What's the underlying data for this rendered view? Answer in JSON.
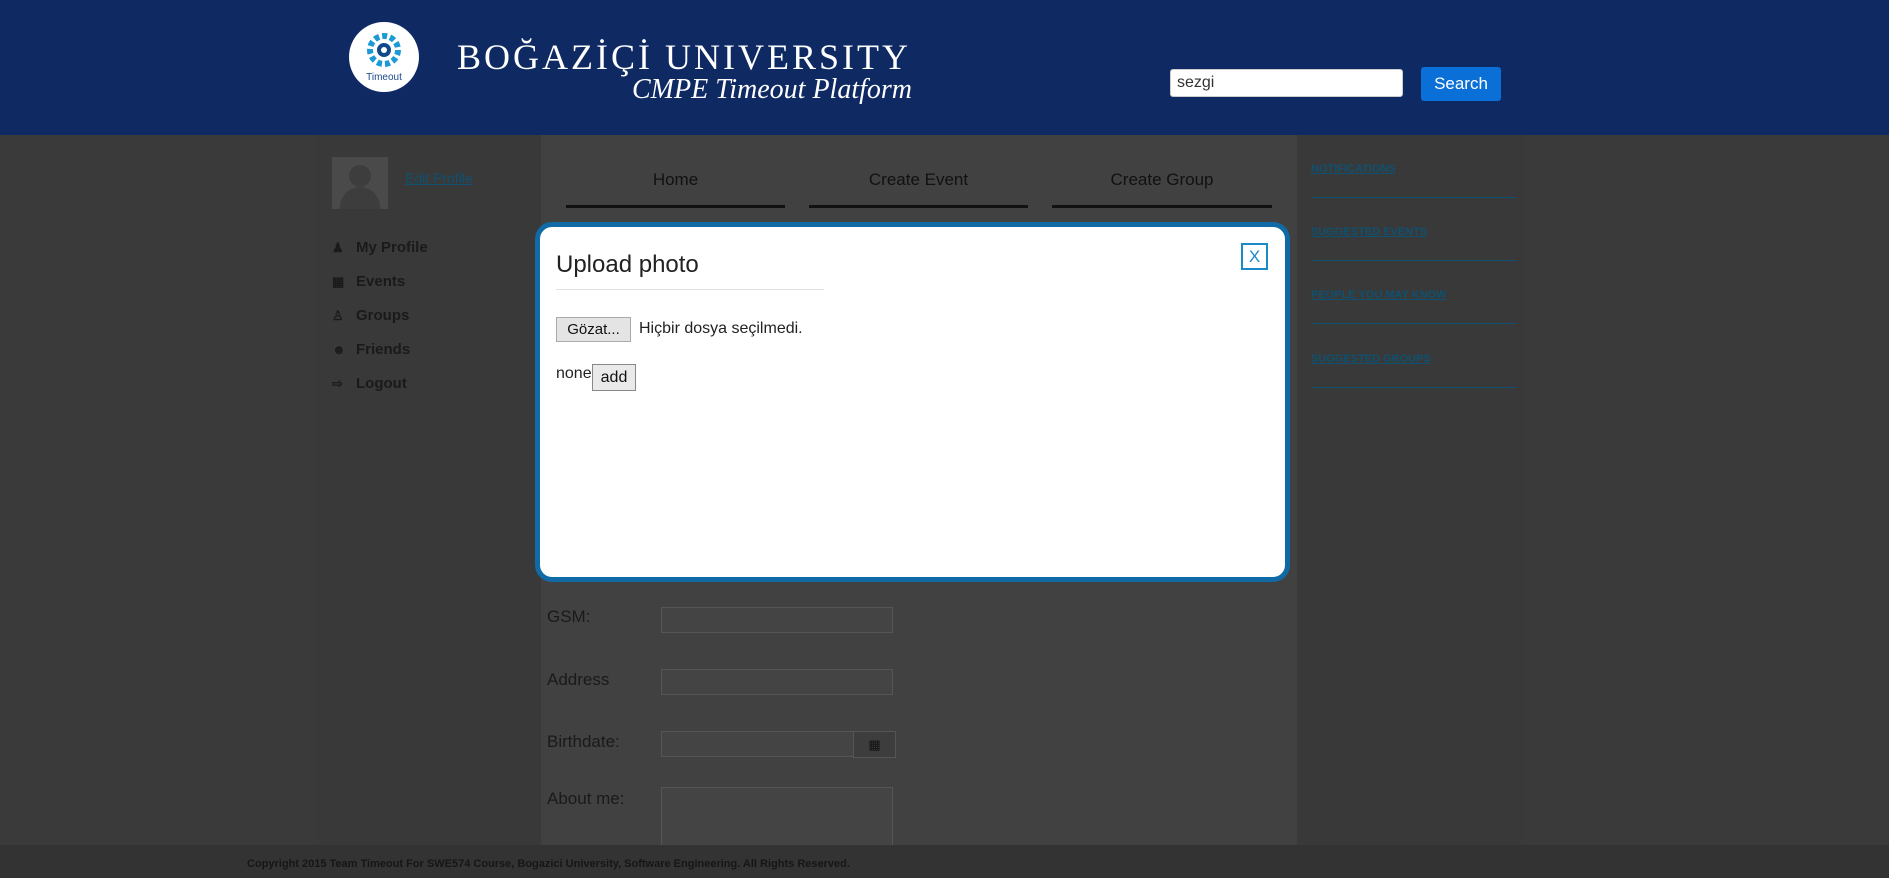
{
  "header": {
    "logo_text": "Timeout",
    "brand_title": "BOĞAZİÇİ UNIVERSITY",
    "brand_subtitle": "CMPE Timeout Platform",
    "search_value": "sezgi",
    "search_button": "Search"
  },
  "sidebar": {
    "edit_profile": "Edit Profile",
    "items": [
      {
        "label": "My Profile",
        "icon": "user-icon"
      },
      {
        "label": "Events",
        "icon": "calendar-icon"
      },
      {
        "label": "Groups",
        "icon": "group-icon"
      },
      {
        "label": "Friends",
        "icon": "friends-icon"
      },
      {
        "label": "Logout",
        "icon": "logout-icon"
      }
    ]
  },
  "tabs": [
    "Home",
    "Create Event",
    "Create Group"
  ],
  "right_panel": {
    "links": [
      "NOTIFICATIONS",
      "SUGGESTED EVENTS",
      "PEOPLE YOU MAY KNOW",
      "SUGGESTED GROUPS"
    ]
  },
  "form": {
    "gsm_label": "GSM:",
    "address_label": "Address",
    "birthdate_label": "Birthdate:",
    "about_label": "About me:"
  },
  "modal": {
    "close": "X",
    "title": "Upload photo",
    "file_button": "Gözat...",
    "file_status": "Hiçbir dosya seçilmedi.",
    "none_text": "none",
    "add_button": "add"
  },
  "footer": {
    "text": "Copyright 2015 Team Timeout For SWE574 Course, Bogazici University, Software Engineering. All Rights Reserved."
  },
  "colors": {
    "header_bg": "#0f2a63",
    "search_button": "#0a6fd6",
    "modal_border": "#0f6aa6",
    "link": "#0e5170"
  }
}
